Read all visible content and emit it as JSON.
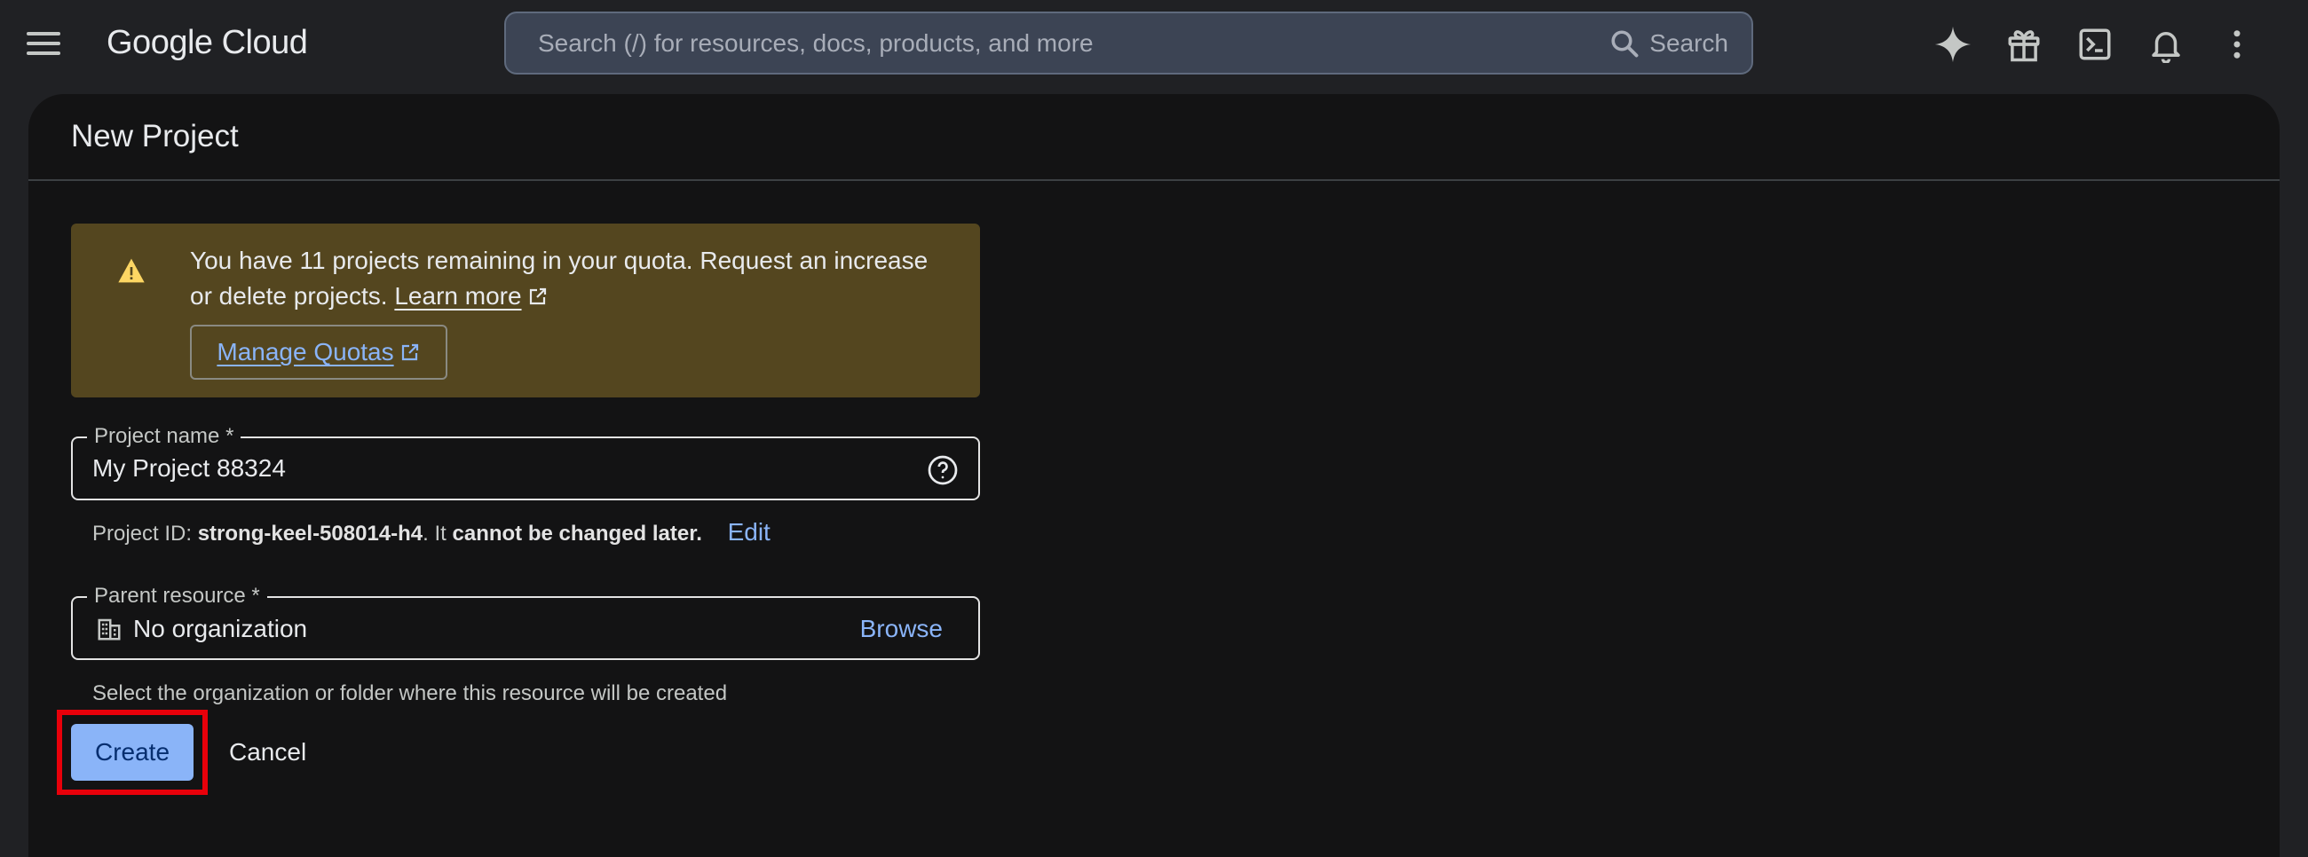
{
  "app": {
    "logo_text": "Google Cloud"
  },
  "search": {
    "placeholder": "Search (/) for resources, docs, products, and more",
    "button_label": "Search"
  },
  "top_icons": [
    "gemini-icon",
    "gift-icon",
    "cloud-shell-icon",
    "notifications-icon",
    "more-vert-icon"
  ],
  "page": {
    "title": "New Project"
  },
  "quota_warning": {
    "text": "You have 11 projects remaining in your quota. Request an increase or delete projects.",
    "learn_more": "Learn more",
    "manage_quotas": "Manage Quotas"
  },
  "project_name": {
    "label": "Project name *",
    "value": "My Project 88324"
  },
  "project_id": {
    "prefix": "Project ID:",
    "id": "strong-keel-508014-h4",
    "mid": ". It",
    "emphasis": "cannot be changed later.",
    "edit_label": "Edit"
  },
  "parent_resource": {
    "label": "Parent resource *",
    "value": "No organization",
    "browse_label": "Browse",
    "hint": "Select the organization or folder where this resource will be created"
  },
  "actions": {
    "create_label": "Create",
    "cancel_label": "Cancel"
  },
  "colors": {
    "background": "#202124",
    "card": "#131314",
    "accent": "#8ab4f8",
    "warning_bg": "#54461f",
    "highlight": "#e8000a"
  }
}
